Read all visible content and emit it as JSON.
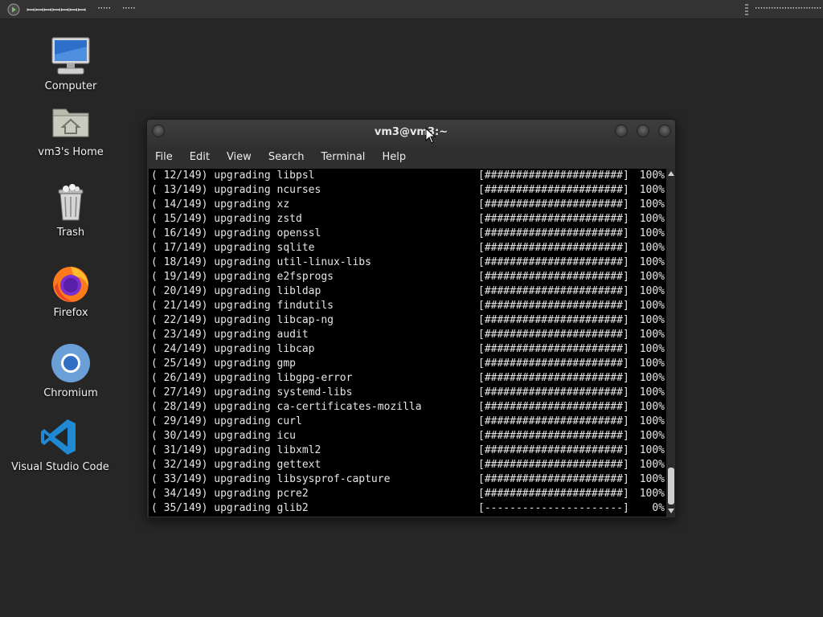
{
  "top_panel": {
    "app_menu_label": "ꟷꟷꟷꟷꟷꟷꟷ",
    "menus": [
      "ᐧᐧᐧᐧᐧ",
      "ᐧᐧᐧᐧᐧ"
    ],
    "clock": "ᐧᐧᐧᐧᐧᐧᐧᐧᐧᐧᐧᐧᐧᐧᐧᐧᐧᐧᐧᐧᐧᐧᐧᐧᐧ"
  },
  "desktop_icons": [
    {
      "label": "Computer",
      "icon": "computer-icon"
    },
    {
      "label": "vm3's Home",
      "icon": "home-folder-icon"
    },
    {
      "label": "Trash",
      "icon": "trash-icon"
    },
    {
      "label": "Firefox",
      "icon": "firefox-icon"
    },
    {
      "label": "Chromium",
      "icon": "chromium-icon"
    },
    {
      "label": "Visual Studio Code",
      "icon": "vscode-icon"
    }
  ],
  "terminal": {
    "title": "vm3@vm3:~",
    "menu": [
      "File",
      "Edit",
      "View",
      "Search",
      "Terminal",
      "Help"
    ],
    "lines": [
      {
        "pkg": "( 12/149) upgrading libpsl",
        "bar": "[######################]",
        "pct": "100%"
      },
      {
        "pkg": "( 13/149) upgrading ncurses",
        "bar": "[######################]",
        "pct": "100%"
      },
      {
        "pkg": "( 14/149) upgrading xz",
        "bar": "[######################]",
        "pct": "100%"
      },
      {
        "pkg": "( 15/149) upgrading zstd",
        "bar": "[######################]",
        "pct": "100%"
      },
      {
        "pkg": "( 16/149) upgrading openssl",
        "bar": "[######################]",
        "pct": "100%"
      },
      {
        "pkg": "( 17/149) upgrading sqlite",
        "bar": "[######################]",
        "pct": "100%"
      },
      {
        "pkg": "( 18/149) upgrading util-linux-libs",
        "bar": "[######################]",
        "pct": "100%"
      },
      {
        "pkg": "( 19/149) upgrading e2fsprogs",
        "bar": "[######################]",
        "pct": "100%"
      },
      {
        "pkg": "( 20/149) upgrading libldap",
        "bar": "[######################]",
        "pct": "100%"
      },
      {
        "pkg": "( 21/149) upgrading findutils",
        "bar": "[######################]",
        "pct": "100%"
      },
      {
        "pkg": "( 22/149) upgrading libcap-ng",
        "bar": "[######################]",
        "pct": "100%"
      },
      {
        "pkg": "( 23/149) upgrading audit",
        "bar": "[######################]",
        "pct": "100%"
      },
      {
        "pkg": "( 24/149) upgrading libcap",
        "bar": "[######################]",
        "pct": "100%"
      },
      {
        "pkg": "( 25/149) upgrading gmp",
        "bar": "[######################]",
        "pct": "100%"
      },
      {
        "pkg": "( 26/149) upgrading libgpg-error",
        "bar": "[######################]",
        "pct": "100%"
      },
      {
        "pkg": "( 27/149) upgrading systemd-libs",
        "bar": "[######################]",
        "pct": "100%"
      },
      {
        "pkg": "( 28/149) upgrading ca-certificates-mozilla",
        "bar": "[######################]",
        "pct": "100%"
      },
      {
        "pkg": "( 29/149) upgrading curl",
        "bar": "[######################]",
        "pct": "100%"
      },
      {
        "pkg": "( 30/149) upgrading icu",
        "bar": "[######################]",
        "pct": "100%"
      },
      {
        "pkg": "( 31/149) upgrading libxml2",
        "bar": "[######################]",
        "pct": "100%"
      },
      {
        "pkg": "( 32/149) upgrading gettext",
        "bar": "[######################]",
        "pct": "100%"
      },
      {
        "pkg": "( 33/149) upgrading libsysprof-capture",
        "bar": "[######################]",
        "pct": "100%"
      },
      {
        "pkg": "( 34/149) upgrading pcre2",
        "bar": "[######################]",
        "pct": "100%"
      },
      {
        "pkg": "( 35/149) upgrading glib2",
        "bar": "[----------------------]",
        "pct": "0%"
      }
    ]
  },
  "colors": {
    "desktop_bg": "#262626",
    "panel_bg": "#333333",
    "terminal_bg": "#000000",
    "terminal_fg": "#e6e6e6"
  }
}
